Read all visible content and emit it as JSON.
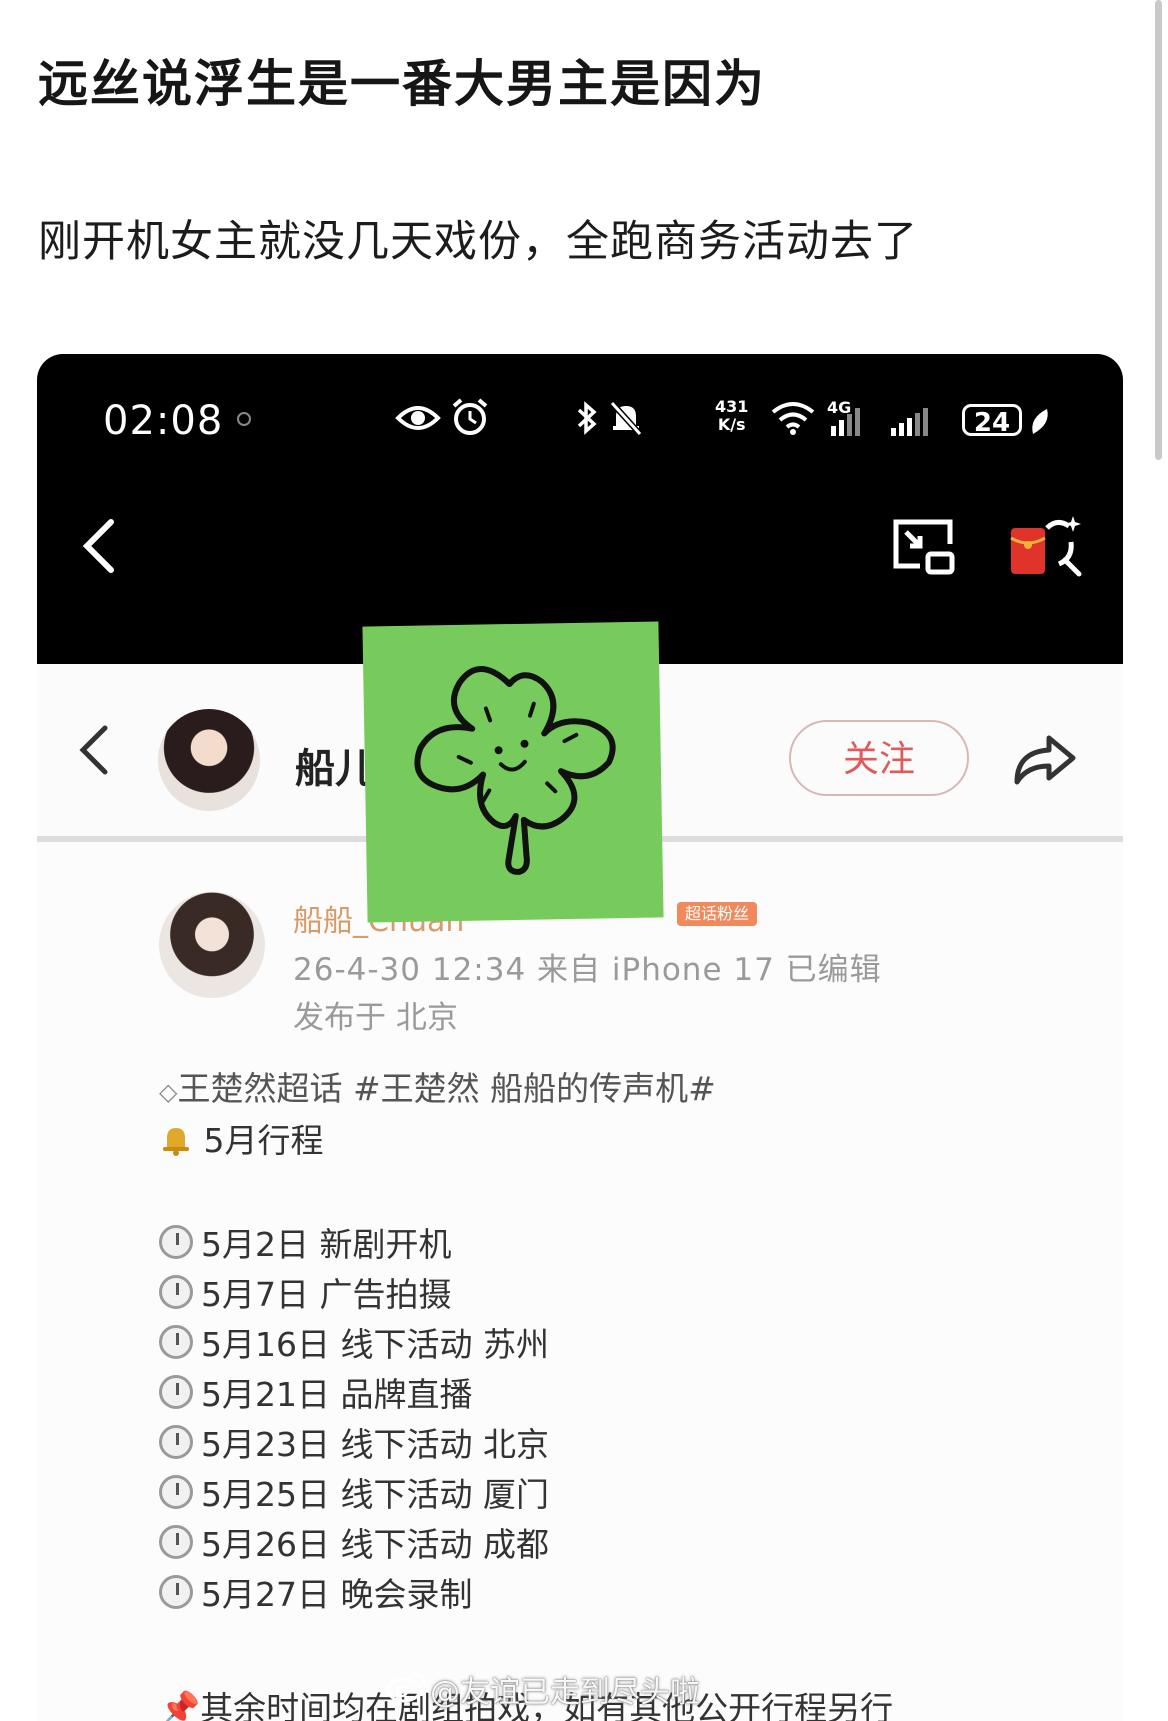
{
  "post": {
    "title": "远丝说浮生是一番大男主是因为",
    "subtitle": "刚开机女主就没几天戏份，全跑商务活动去了"
  },
  "statusbar": {
    "time": "02:08",
    "net_speed_top": "431",
    "net_speed_unit": "K/s",
    "signal_label": "4G",
    "battery": "24"
  },
  "profile_bar": {
    "name": "船儿",
    "follow_label": "关注"
  },
  "post_card": {
    "author": "船船_Chuan",
    "badge": "超话粉丝",
    "meta": "26-4-30 12:34  来自 iPhone 17  已编辑",
    "location": "发布于 北京",
    "topic": "王楚然超话 #王楚然 船船的传声机#",
    "heading": "5月行程",
    "schedule": [
      "5月2日 新剧开机",
      "5月7日 广告拍摄",
      "5月16日 线下活动 苏州",
      "5月21日 品牌直播",
      "5月23日 线下活动 北京",
      "5月25日 线下活动 厦门",
      "5月26日 线下活动 成都",
      "5月27日 晚会录制"
    ],
    "footer": "其余时间均在剧组拍戏，如有其他公开行程另行"
  },
  "watermark": "@友谊已走到尽头啦",
  "colors": {
    "follow": "#e05a5a",
    "sticker": "#77cb5c",
    "author_name": "#d89a66"
  }
}
